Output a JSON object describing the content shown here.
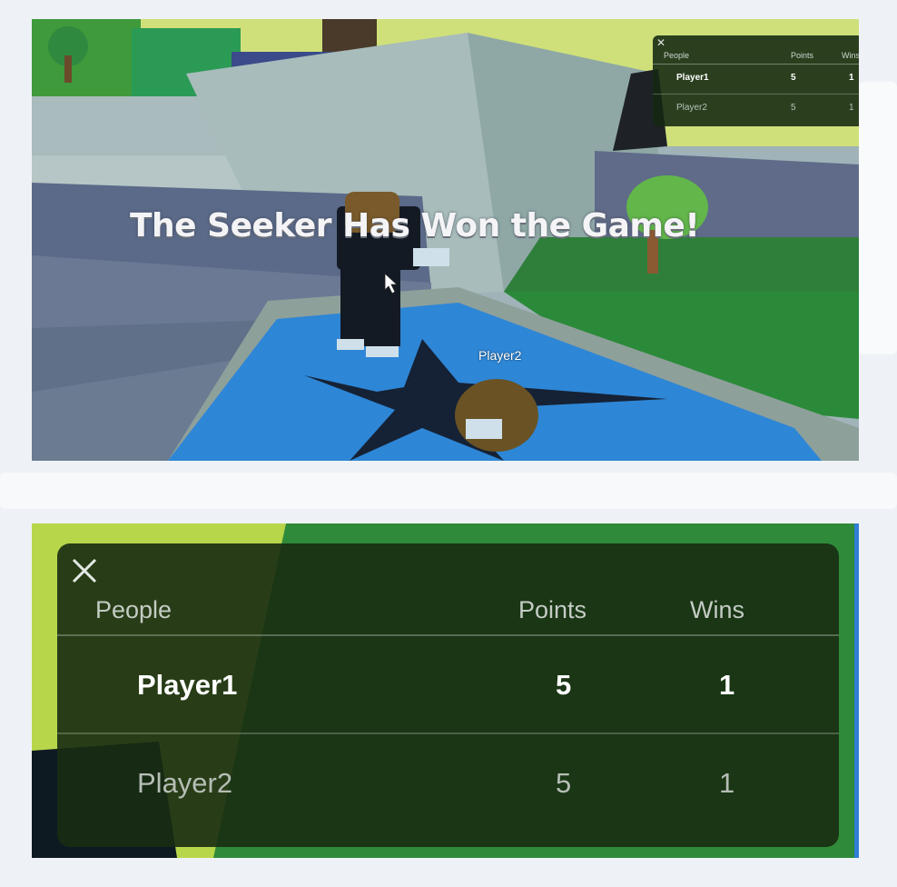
{
  "game_view": {
    "banner_text": "The Seeker Has Won the Game!",
    "player_name_tag": "Player2"
  },
  "leaderboard": {
    "close_icon": "close-icon",
    "columns": {
      "people": "People",
      "points": "Points",
      "wins": "Wins"
    },
    "rows": [
      {
        "name": "Player1",
        "points": "5",
        "wins": "1",
        "highlighted": true
      },
      {
        "name": "Player2",
        "points": "5",
        "wins": "1",
        "highlighted": false
      }
    ]
  },
  "colors": {
    "board_bg": "#182c12",
    "banner_text": "#f4f4f6",
    "floor_blue": "#2e86d6",
    "grass_green": "#2f8a3a"
  }
}
